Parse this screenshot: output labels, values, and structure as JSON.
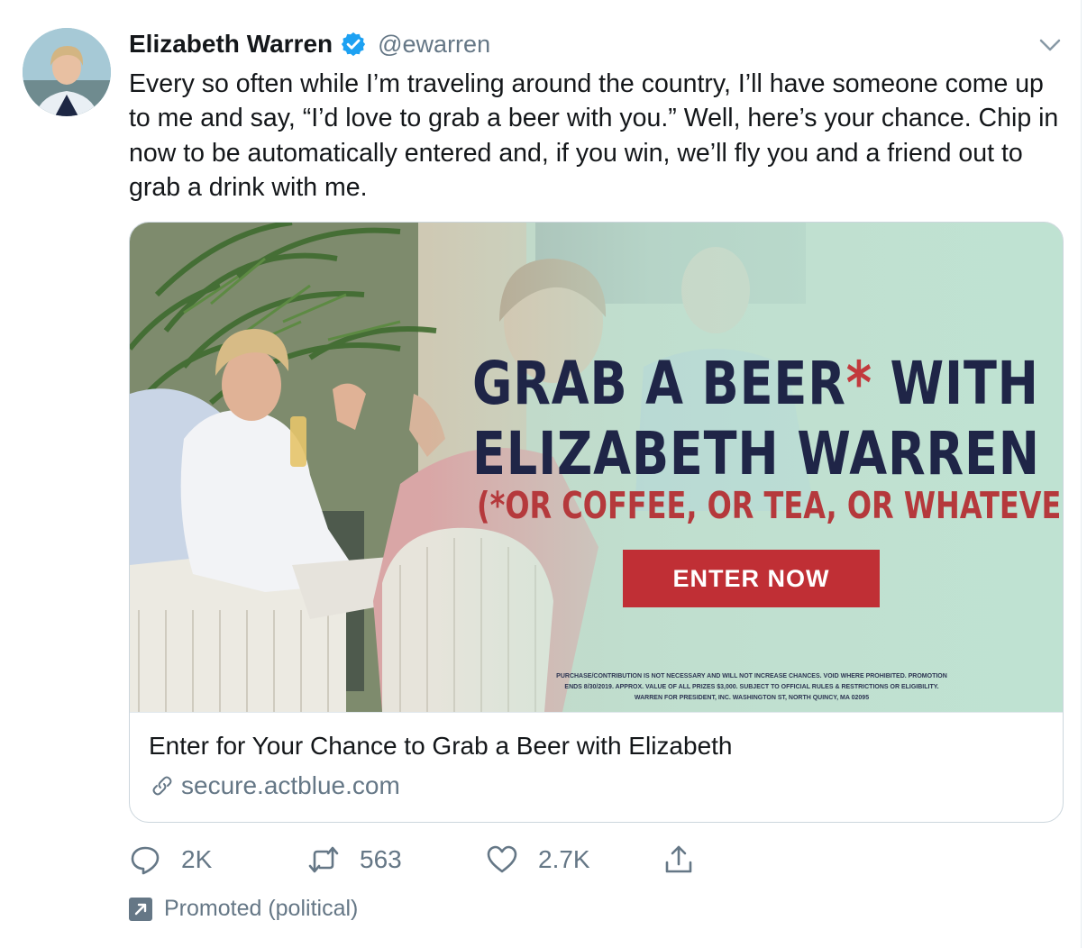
{
  "author": {
    "display_name": "Elizabeth Warren",
    "handle": "@ewarren",
    "verified": true
  },
  "tweet": {
    "text": "Every so often while I’m traveling around the country, I’ll have someone come up to me and say, “I’d love to grab a beer with you.” Well, here’s your chance. Chip in now to be automatically entered and, if you win, we’ll fly you and a friend out to grab a drink with me."
  },
  "card": {
    "image": {
      "headline_line1": "GRAB A BEER",
      "headline_asterisk": "*",
      "headline_line1_end": " WITH",
      "headline_line2": "ELIZABETH WARREN",
      "subhead": "(*OR COFFEE, OR TEA, OR WHATEVER)",
      "cta": "ENTER NOW",
      "fine_print": "PURCHASE/CONTRIBUTION IS NOT NECESSARY AND WILL NOT INCREASE CHANCES. VOID WHERE PROHIBITED. PROMOTION ENDS 8/30/2019. APPROX. VALUE OF ALL PRIZES $3,000. SUBJECT TO OFFICIAL RULES & RESTRICTIONS OR ELIGIBILITY. WARREN FOR PRESIDENT, INC. WASHINGTON ST, NORTH QUINCY, MA 02095"
    },
    "title": "Enter for Your Chance to Grab a Beer with Elizabeth",
    "domain": "secure.actblue.com"
  },
  "actions": {
    "replies": "2K",
    "retweets": "563",
    "likes": "2.7K"
  },
  "promoted_label": "Promoted (political)",
  "colors": {
    "verified_blue": "#1da1f2",
    "muted_text": "#657786",
    "ad_navy": "#1f2547",
    "ad_red": "#c02f35",
    "ad_mint": "#bfe3d3"
  }
}
